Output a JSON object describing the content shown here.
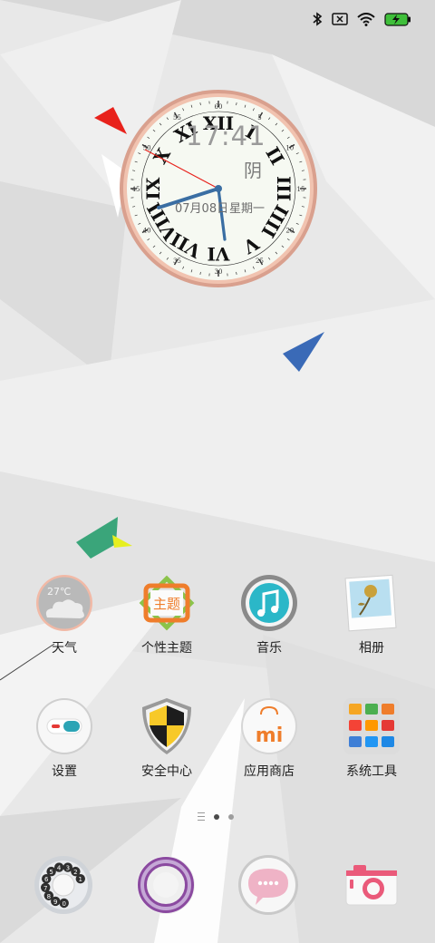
{
  "status_bar": {
    "icons": [
      "bluetooth-icon",
      "sim-error-icon",
      "wifi-icon",
      "battery-charging-icon"
    ]
  },
  "clock_widget": {
    "time": "17:41",
    "weather": "阴",
    "date": "07月08日",
    "weekday": "星期一",
    "minute_marks": [
      "5",
      "10",
      "15",
      "20",
      "25",
      "30",
      "35",
      "40",
      "45",
      "50",
      "55",
      "60"
    ],
    "hour_numerals": [
      "I",
      "II",
      "III",
      "IIII",
      "V",
      "VI",
      "VII",
      "VIII",
      "IX",
      "X",
      "XI",
      "XII"
    ]
  },
  "apps": [
    {
      "label": "天气",
      "icon": "weather-icon",
      "temperature": "27℃"
    },
    {
      "label": "个性主题",
      "icon": "theme-icon",
      "icon_text": "主题"
    },
    {
      "label": "音乐",
      "icon": "music-icon"
    },
    {
      "label": "相册",
      "icon": "gallery-icon"
    },
    {
      "label": "设置",
      "icon": "settings-icon"
    },
    {
      "label": "安全中心",
      "icon": "security-icon"
    },
    {
      "label": "应用商店",
      "icon": "app-store-icon",
      "icon_text": "mi"
    },
    {
      "label": "系统工具",
      "icon": "system-tools-icon"
    }
  ],
  "page_indicator": {
    "pages": 2,
    "current": 1
  },
  "dock": [
    {
      "icon": "phone-icon",
      "dial_digits": [
        "1",
        "2",
        "3",
        "4",
        "5",
        "6",
        "7",
        "8",
        "9",
        "0"
      ]
    },
    {
      "icon": "browser-icon"
    },
    {
      "icon": "messages-icon"
    },
    {
      "icon": "camera-icon"
    }
  ],
  "colors": {
    "accent_blue": "#3a6ab7",
    "accent_red": "#e8221c",
    "accent_green": "#3aa57a",
    "theme_orange": "#ef7d2b"
  }
}
